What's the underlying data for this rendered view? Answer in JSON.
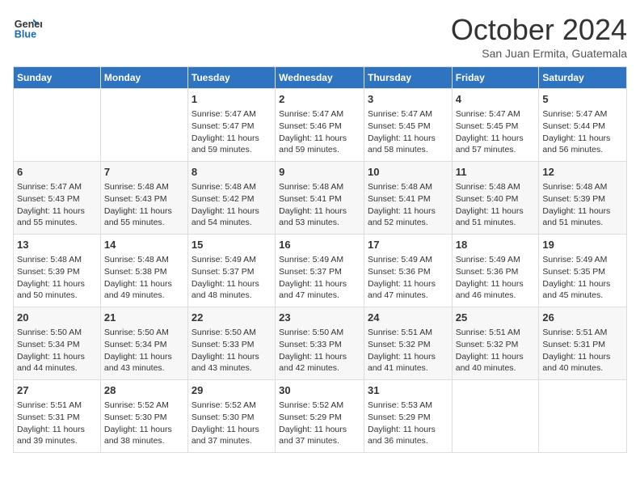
{
  "header": {
    "logo_line1": "General",
    "logo_line2": "Blue",
    "month": "October 2024",
    "location": "San Juan Ermita, Guatemala"
  },
  "days_of_week": [
    "Sunday",
    "Monday",
    "Tuesday",
    "Wednesday",
    "Thursday",
    "Friday",
    "Saturday"
  ],
  "weeks": [
    [
      {
        "day": "",
        "info": ""
      },
      {
        "day": "",
        "info": ""
      },
      {
        "day": "1",
        "info": "Sunrise: 5:47 AM\nSunset: 5:47 PM\nDaylight: 11 hours\nand 59 minutes."
      },
      {
        "day": "2",
        "info": "Sunrise: 5:47 AM\nSunset: 5:46 PM\nDaylight: 11 hours\nand 59 minutes."
      },
      {
        "day": "3",
        "info": "Sunrise: 5:47 AM\nSunset: 5:45 PM\nDaylight: 11 hours\nand 58 minutes."
      },
      {
        "day": "4",
        "info": "Sunrise: 5:47 AM\nSunset: 5:45 PM\nDaylight: 11 hours\nand 57 minutes."
      },
      {
        "day": "5",
        "info": "Sunrise: 5:47 AM\nSunset: 5:44 PM\nDaylight: 11 hours\nand 56 minutes."
      }
    ],
    [
      {
        "day": "6",
        "info": "Sunrise: 5:47 AM\nSunset: 5:43 PM\nDaylight: 11 hours\nand 55 minutes."
      },
      {
        "day": "7",
        "info": "Sunrise: 5:48 AM\nSunset: 5:43 PM\nDaylight: 11 hours\nand 55 minutes."
      },
      {
        "day": "8",
        "info": "Sunrise: 5:48 AM\nSunset: 5:42 PM\nDaylight: 11 hours\nand 54 minutes."
      },
      {
        "day": "9",
        "info": "Sunrise: 5:48 AM\nSunset: 5:41 PM\nDaylight: 11 hours\nand 53 minutes."
      },
      {
        "day": "10",
        "info": "Sunrise: 5:48 AM\nSunset: 5:41 PM\nDaylight: 11 hours\nand 52 minutes."
      },
      {
        "day": "11",
        "info": "Sunrise: 5:48 AM\nSunset: 5:40 PM\nDaylight: 11 hours\nand 51 minutes."
      },
      {
        "day": "12",
        "info": "Sunrise: 5:48 AM\nSunset: 5:39 PM\nDaylight: 11 hours\nand 51 minutes."
      }
    ],
    [
      {
        "day": "13",
        "info": "Sunrise: 5:48 AM\nSunset: 5:39 PM\nDaylight: 11 hours\nand 50 minutes."
      },
      {
        "day": "14",
        "info": "Sunrise: 5:48 AM\nSunset: 5:38 PM\nDaylight: 11 hours\nand 49 minutes."
      },
      {
        "day": "15",
        "info": "Sunrise: 5:49 AM\nSunset: 5:37 PM\nDaylight: 11 hours\nand 48 minutes."
      },
      {
        "day": "16",
        "info": "Sunrise: 5:49 AM\nSunset: 5:37 PM\nDaylight: 11 hours\nand 47 minutes."
      },
      {
        "day": "17",
        "info": "Sunrise: 5:49 AM\nSunset: 5:36 PM\nDaylight: 11 hours\nand 47 minutes."
      },
      {
        "day": "18",
        "info": "Sunrise: 5:49 AM\nSunset: 5:36 PM\nDaylight: 11 hours\nand 46 minutes."
      },
      {
        "day": "19",
        "info": "Sunrise: 5:49 AM\nSunset: 5:35 PM\nDaylight: 11 hours\nand 45 minutes."
      }
    ],
    [
      {
        "day": "20",
        "info": "Sunrise: 5:50 AM\nSunset: 5:34 PM\nDaylight: 11 hours\nand 44 minutes."
      },
      {
        "day": "21",
        "info": "Sunrise: 5:50 AM\nSunset: 5:34 PM\nDaylight: 11 hours\nand 43 minutes."
      },
      {
        "day": "22",
        "info": "Sunrise: 5:50 AM\nSunset: 5:33 PM\nDaylight: 11 hours\nand 43 minutes."
      },
      {
        "day": "23",
        "info": "Sunrise: 5:50 AM\nSunset: 5:33 PM\nDaylight: 11 hours\nand 42 minutes."
      },
      {
        "day": "24",
        "info": "Sunrise: 5:51 AM\nSunset: 5:32 PM\nDaylight: 11 hours\nand 41 minutes."
      },
      {
        "day": "25",
        "info": "Sunrise: 5:51 AM\nSunset: 5:32 PM\nDaylight: 11 hours\nand 40 minutes."
      },
      {
        "day": "26",
        "info": "Sunrise: 5:51 AM\nSunset: 5:31 PM\nDaylight: 11 hours\nand 40 minutes."
      }
    ],
    [
      {
        "day": "27",
        "info": "Sunrise: 5:51 AM\nSunset: 5:31 PM\nDaylight: 11 hours\nand 39 minutes."
      },
      {
        "day": "28",
        "info": "Sunrise: 5:52 AM\nSunset: 5:30 PM\nDaylight: 11 hours\nand 38 minutes."
      },
      {
        "day": "29",
        "info": "Sunrise: 5:52 AM\nSunset: 5:30 PM\nDaylight: 11 hours\nand 37 minutes."
      },
      {
        "day": "30",
        "info": "Sunrise: 5:52 AM\nSunset: 5:29 PM\nDaylight: 11 hours\nand 37 minutes."
      },
      {
        "day": "31",
        "info": "Sunrise: 5:53 AM\nSunset: 5:29 PM\nDaylight: 11 hours\nand 36 minutes."
      },
      {
        "day": "",
        "info": ""
      },
      {
        "day": "",
        "info": ""
      }
    ]
  ]
}
